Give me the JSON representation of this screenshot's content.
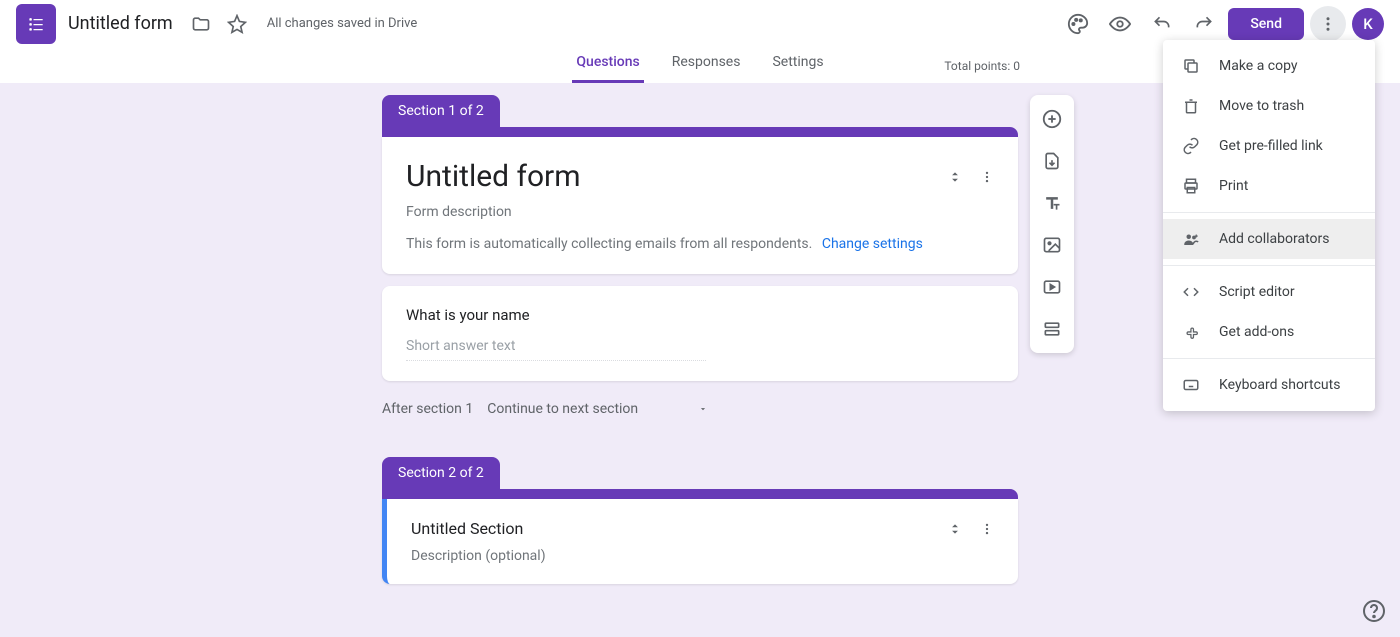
{
  "header": {
    "form_title": "Untitled form",
    "save_status": "All changes saved in Drive",
    "send_label": "Send",
    "avatar_initial": "K"
  },
  "tabs": {
    "questions": "Questions",
    "responses": "Responses",
    "settings": "Settings",
    "total_points": "Total points: 0"
  },
  "section1": {
    "tab_label": "Section 1 of 2",
    "title": "Untitled form",
    "description": "Form description",
    "email_notice": "This form is automatically collecting emails from all respondents.",
    "change_settings": "Change settings"
  },
  "question1": {
    "title": "What is your name",
    "placeholder_text": "Short answer text"
  },
  "after_section": {
    "label": "After section 1",
    "option": "Continue to next section"
  },
  "section2": {
    "tab_label": "Section 2 of 2",
    "title": "Untitled Section",
    "description": "Description (optional)"
  },
  "menu": {
    "copy": "Make a copy",
    "trash": "Move to trash",
    "prefilled": "Get pre-filled link",
    "print": "Print",
    "collaborators": "Add collaborators",
    "script": "Script editor",
    "addons": "Get add-ons",
    "shortcuts": "Keyboard shortcuts"
  }
}
